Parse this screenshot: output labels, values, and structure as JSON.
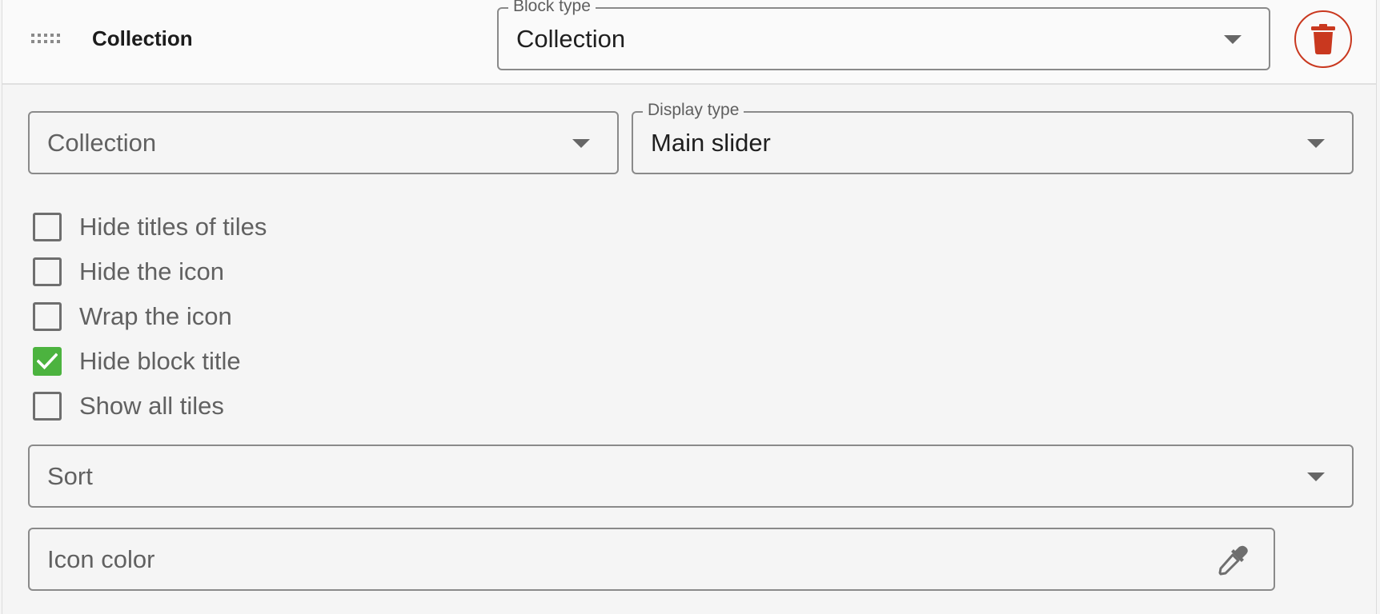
{
  "header": {
    "title": "Collection",
    "block_type": {
      "label": "Block type",
      "value": "Collection"
    }
  },
  "fields": {
    "collection": {
      "placeholder": "Collection"
    },
    "display_type": {
      "label": "Display type",
      "value": "Main slider"
    },
    "sort": {
      "placeholder": "Sort"
    },
    "icon_color": {
      "placeholder": "Icon color"
    }
  },
  "options": [
    {
      "label": "Hide titles of tiles",
      "checked": false
    },
    {
      "label": "Hide the icon",
      "checked": false
    },
    {
      "label": "Wrap the icon",
      "checked": false
    },
    {
      "label": "Hide block title",
      "checked": true
    },
    {
      "label": "Show all tiles",
      "checked": false
    }
  ],
  "icons": {
    "drag": "drag-handle-icon",
    "delete": "trash-icon",
    "dropdown": "caret-down-icon",
    "picker": "eyedropper-icon",
    "check": "checkmark-icon"
  },
  "colors": {
    "delete_accent": "#c9381f",
    "checked_accent": "#4cb33f"
  }
}
